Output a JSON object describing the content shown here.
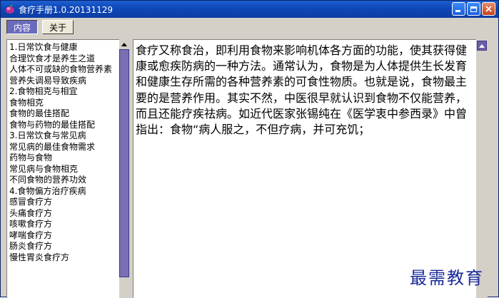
{
  "window": {
    "title": "食疗手册1.0.20131129",
    "accent": "#0f47b8"
  },
  "toolbar": {
    "content_label": "内容",
    "about_label": "关于"
  },
  "sidebar": {
    "items": [
      "1.日常饮食与健康",
      "合理饮食才是养生之道",
      "人体不可或缺的食物营养素",
      "营养失调易导致疾病",
      "2.食物相克与相宜",
      "食物相克",
      "食物的最佳搭配",
      "食物与药物的最佳搭配",
      "3.日常饮食与常见病",
      "常见病的最佳食物需求",
      "药物与食物",
      "常见病与食物相克",
      "不同食物的营养功效",
      "4.食物偏方治疗疾病",
      "感冒食疗方",
      "头痛食疗方",
      "咳嗽食疗方",
      "哮喘食疗方",
      "肠炎食疗方",
      "慢性胃炎食疗方"
    ]
  },
  "content": {
    "text": "食疗又称食治，即利用食物来影响机体各方面的功能，使其获得健康或愈疾防病的一种方法。通常认为，食物是为人体提供生长发育和健康生存所需的各种营养素的可食性物质。也就是说，食物最主要的是营养作用。其实不然，中医很早就认识到食物不仅能营养，而且还能疗疾祛病。如近代医家张锡纯在《医学衷中参西录》中曾指出：食物“病人服之，不但疗病，并可充饥；"
  },
  "watermark": {
    "text": "最需教育"
  }
}
